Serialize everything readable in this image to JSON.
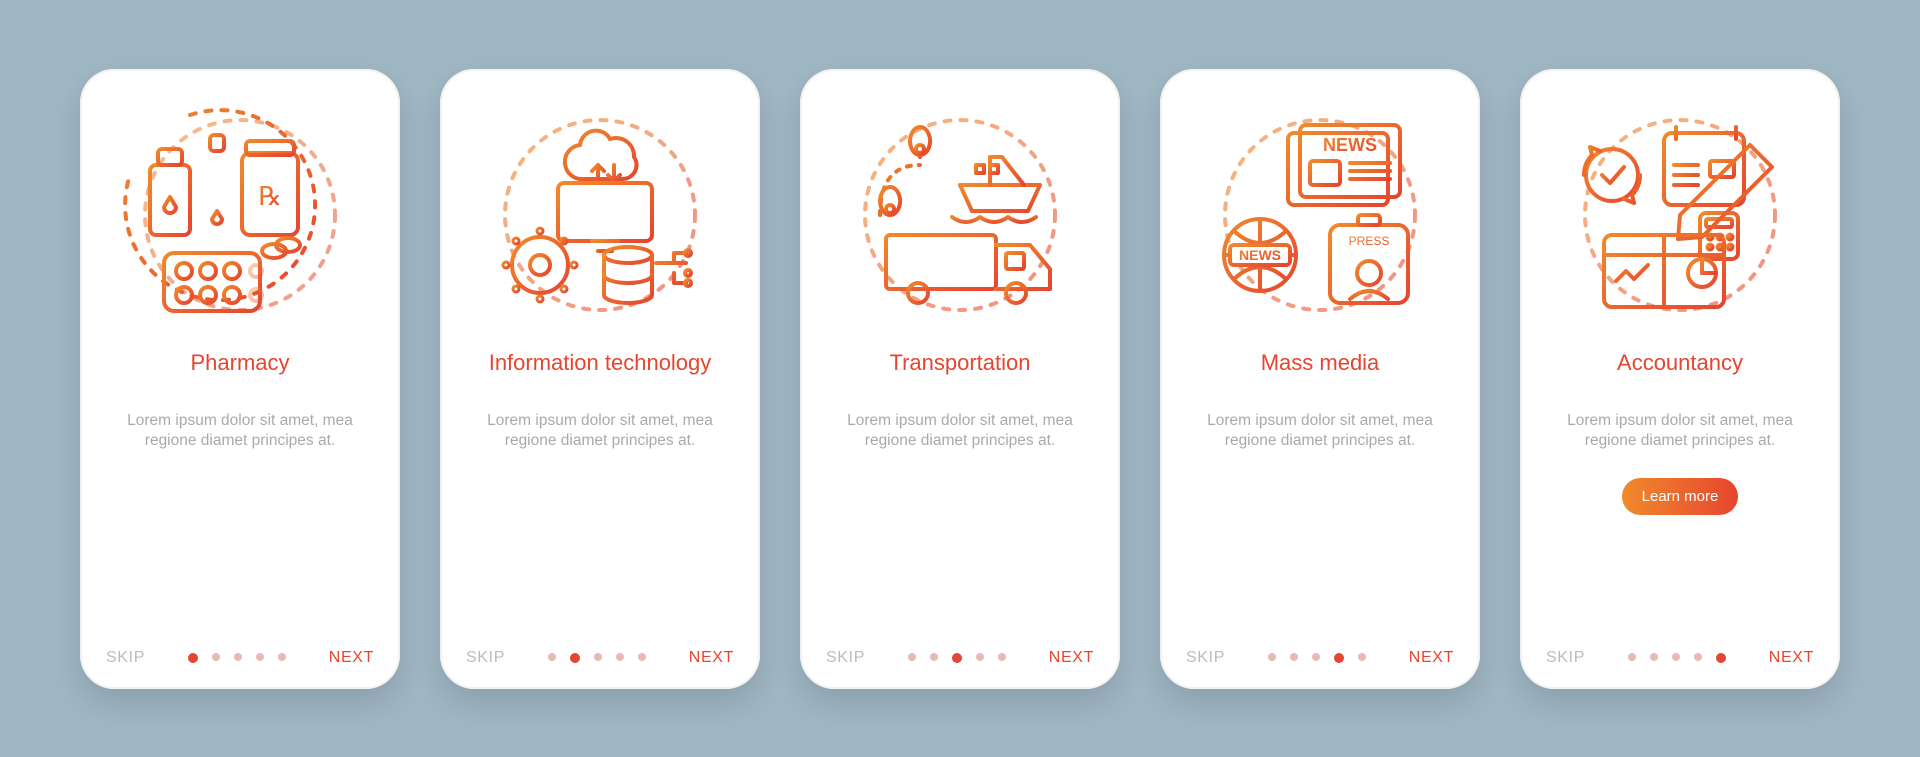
{
  "colors": {
    "accent": "#E6452F",
    "accentAlt": "#F08A2C"
  },
  "slides": [
    {
      "title": "Pharmacy",
      "desc": "Lorem ipsum dolor sit amet, mea regione diamet principes at.",
      "skip": "SKIP",
      "next": "NEXT",
      "dotsTotal": 5,
      "activeDot": 0,
      "hasCta": false
    },
    {
      "title": "Information technology",
      "desc": "Lorem ipsum dolor sit amet, mea regione diamet principes at.",
      "skip": "SKIP",
      "next": "NEXT",
      "dotsTotal": 5,
      "activeDot": 1,
      "hasCta": false
    },
    {
      "title": "Transportation",
      "desc": "Lorem ipsum dolor sit amet, mea regione diamet principes at.",
      "skip": "SKIP",
      "next": "NEXT",
      "dotsTotal": 5,
      "activeDot": 2,
      "hasCta": false
    },
    {
      "title": "Mass media",
      "desc": "Lorem ipsum dolor sit amet, mea regione diamet principes at.",
      "skip": "SKIP",
      "next": "NEXT",
      "dotsTotal": 5,
      "activeDot": 3,
      "hasCta": false
    },
    {
      "title": "Accountancy",
      "desc": "Lorem ipsum dolor sit amet, mea regione diamet principes at.",
      "skip": "SKIP",
      "next": "NEXT",
      "dotsTotal": 5,
      "activeDot": 4,
      "hasCta": true,
      "cta": "Learn more"
    }
  ]
}
